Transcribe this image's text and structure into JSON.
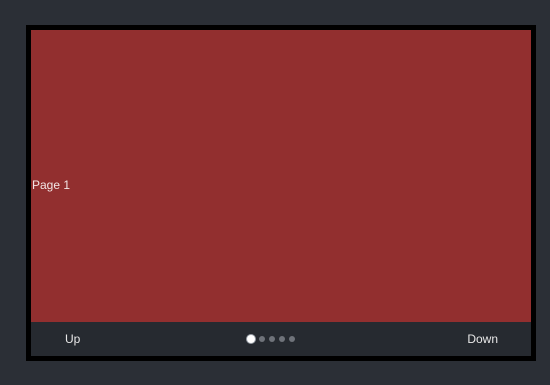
{
  "pager": {
    "page_label": "Page 1",
    "up_label": "Up",
    "down_label": "Down",
    "total_pages": 5,
    "active_page": 1
  },
  "colors": {
    "background": "#2b2f36",
    "frame": "#000000",
    "page": "#922f2f",
    "nav_bar": "#262a30",
    "dot_active": "#ffffff",
    "dot_inactive": "#6f737a"
  }
}
